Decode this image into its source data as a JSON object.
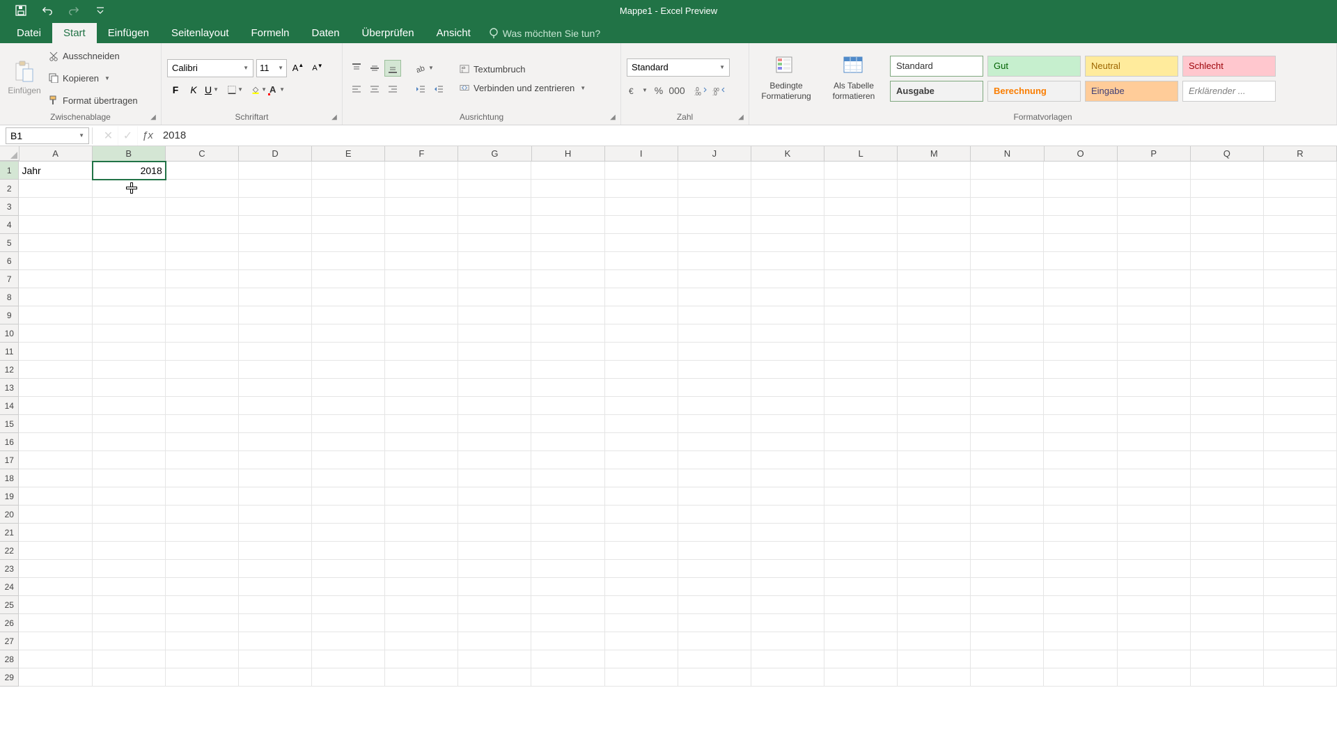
{
  "titlebar": {
    "title": "Mappe1  -  Excel Preview"
  },
  "tabs": {
    "file": "Datei",
    "items": [
      "Start",
      "Einfügen",
      "Seitenlayout",
      "Formeln",
      "Daten",
      "Überprüfen",
      "Ansicht"
    ],
    "active_index": 0,
    "search_placeholder": "Was möchten Sie tun?"
  },
  "ribbon": {
    "clipboard": {
      "paste": "Einfügen",
      "cut": "Ausschneiden",
      "copy": "Kopieren",
      "format_painter": "Format übertragen",
      "group": "Zwischenablage"
    },
    "font": {
      "name": "Calibri",
      "size": "11",
      "group": "Schriftart"
    },
    "alignment": {
      "wrap": "Textumbruch",
      "merge": "Verbinden und zentrieren",
      "group": "Ausrichtung"
    },
    "number": {
      "format": "Standard",
      "group": "Zahl"
    },
    "styles": {
      "cond": "Bedingte Formatierung",
      "table": "Als Tabelle formatieren",
      "cells": [
        {
          "label": "Standard",
          "bg": "#ffffff",
          "fg": "#333333",
          "border": "#7fa87f"
        },
        {
          "label": "Gut",
          "bg": "#c6efce",
          "fg": "#006100",
          "border": "#cccccc"
        },
        {
          "label": "Neutral",
          "bg": "#ffeb9c",
          "fg": "#9c6500",
          "border": "#cccccc"
        },
        {
          "label": "Schlecht",
          "bg": "#ffc7ce",
          "fg": "#9c0006",
          "border": "#cccccc"
        },
        {
          "label": "Ausgabe",
          "bg": "#f2f2f2",
          "fg": "#3f3f3f",
          "border": "#7fa87f",
          "bold": true
        },
        {
          "label": "Berechnung",
          "bg": "#f2f2f2",
          "fg": "#fa7d00",
          "border": "#cccccc",
          "bold": true
        },
        {
          "label": "Eingabe",
          "bg": "#ffcc99",
          "fg": "#3f3f76",
          "border": "#cccccc"
        },
        {
          "label": "Erklärender ...",
          "bg": "#ffffff",
          "fg": "#7f7f7f",
          "border": "#cccccc",
          "italic": true
        }
      ],
      "group": "Formatvorlagen"
    }
  },
  "formula_bar": {
    "name_box": "B1",
    "formula": "2018"
  },
  "sheet": {
    "columns": [
      "A",
      "B",
      "C",
      "D",
      "E",
      "F",
      "G",
      "H",
      "I",
      "J",
      "K",
      "L",
      "M",
      "N",
      "O",
      "P",
      "Q",
      "R"
    ],
    "selected_col_index": 1,
    "rows": 29,
    "selected_row_index": 0,
    "cells": {
      "A1": {
        "value": "Jahr",
        "align": "left"
      },
      "B1": {
        "value": "2018",
        "align": "right",
        "selected": true
      }
    },
    "cursor": {
      "row": 1,
      "col": 1
    }
  }
}
